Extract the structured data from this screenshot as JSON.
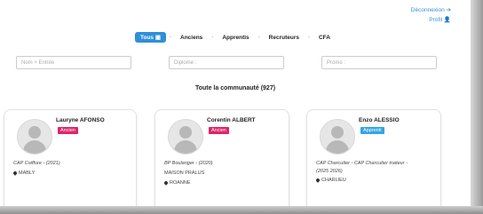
{
  "top_links": {
    "logout": "Déconnexion",
    "profile": "Profil"
  },
  "tabs": [
    {
      "label": "Tous",
      "active": true
    },
    {
      "label": "Anciens",
      "active": false
    },
    {
      "label": "Apprentis",
      "active": false
    },
    {
      "label": "Recruteurs",
      "active": false
    },
    {
      "label": "CFA",
      "active": false
    }
  ],
  "filters": {
    "name_placeholder": "Nom + Entrée",
    "diploma_placeholder": "Diplome :",
    "promo_placeholder": "Promo :"
  },
  "community_count": "Toute la communauté (927)",
  "colors": {
    "accent": "#2f8fd8",
    "ancien_badge": "#e0246b",
    "apprenti_badge": "#35a6e0"
  },
  "members": [
    {
      "name": "Lauryne AFONSO",
      "badge": "Ancien",
      "badge_type": "ancien",
      "line1": "CAP Coiffure - (2021)",
      "line2": "",
      "location": "MABLY"
    },
    {
      "name": "Corentin ALBERT",
      "badge": "Ancien",
      "badge_type": "ancien",
      "line1": "BP Boulanger - (2020)",
      "line2": "MAISON PRALUS",
      "location": "ROANNE"
    },
    {
      "name": "Enzo ALESSIO",
      "badge": "Apprenti",
      "badge_type": "apprenti",
      "line1": "CAP Charcutier - CAP Charcutier traiteur -",
      "line2": "(2025 2026)",
      "location": "CHARLIEU"
    }
  ]
}
